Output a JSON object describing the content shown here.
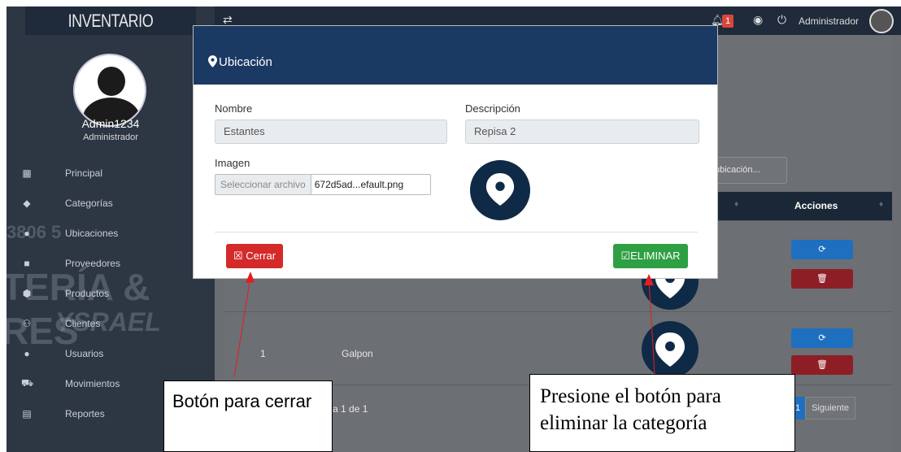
{
  "sidebar": {
    "brand": "INVENTARIO",
    "user_name": "Admin1234",
    "user_role": "Administrador",
    "items": [
      {
        "label": "Principal",
        "icon": "dashboard-icon"
      },
      {
        "label": "Categorías",
        "icon": "tag-icon"
      },
      {
        "label": "Ubicaciones",
        "icon": "map-marker-icon"
      },
      {
        "label": "Proveedores",
        "icon": "truck-icon"
      },
      {
        "label": "Productos",
        "icon": "box-icon"
      },
      {
        "label": "Clientes",
        "icon": "users-icon"
      },
      {
        "label": "Usuarios",
        "icon": "user-icon"
      },
      {
        "label": "Movimientos",
        "icon": "cart-icon"
      },
      {
        "label": "Reportes",
        "icon": "document-icon"
      }
    ]
  },
  "topbar": {
    "notifications_count": "1",
    "user": "Administrador"
  },
  "content": {
    "search_placeholder": "ubicación...",
    "table": {
      "header_actions": "Acciones",
      "rows": [
        {
          "id": "1",
          "name": "Galpon"
        }
      ]
    },
    "pagination": {
      "info": "a 1 de 1",
      "current_page": "1",
      "next_label": "Siguiente"
    }
  },
  "modal": {
    "title": "Ubicación",
    "nombre_label": "Nombre",
    "nombre_value": "Estantes",
    "descripcion_label": "Descripción",
    "descripcion_value": "Repisa 2",
    "imagen_label": "Imagen",
    "file_button": "Seleccionar archivo",
    "file_name": "672d5ad...efault.png",
    "close_button": "Cerrar",
    "delete_button": "ELIMINAR"
  },
  "annotations": {
    "left": "Botón para cerrar",
    "right": "Presione el botón para eliminar la categoría"
  },
  "colors": {
    "header": "#1b3a63",
    "danger": "#d42a2a",
    "success": "#2ea043",
    "primary": "#1e6fc0"
  }
}
